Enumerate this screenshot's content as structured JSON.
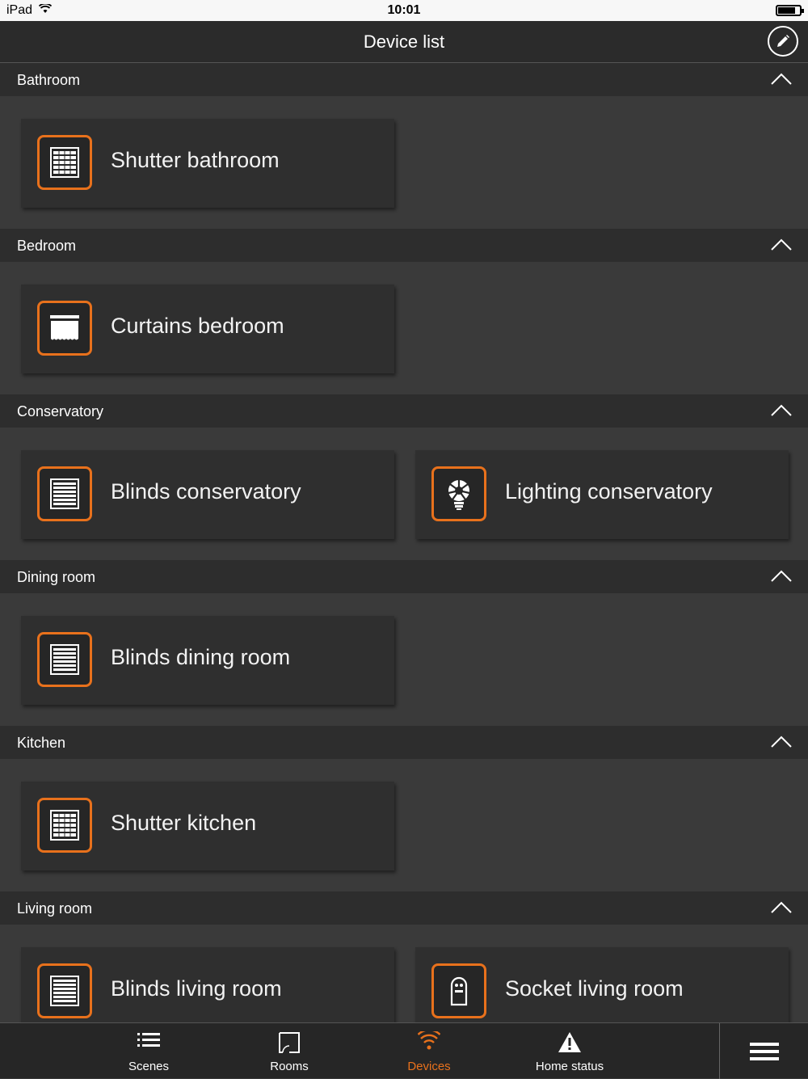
{
  "status_bar": {
    "device": "iPad",
    "time": "10:01"
  },
  "header": {
    "title": "Device list"
  },
  "colors": {
    "accent": "#e8711c",
    "background": "#3a3a3a",
    "header": "#2d2d2d"
  },
  "sections": [
    {
      "label": "Bathroom",
      "devices": [
        {
          "label": "Shutter bathroom",
          "icon": "shutter-icon"
        }
      ]
    },
    {
      "label": "Bedroom",
      "devices": [
        {
          "label": "Curtains bedroom",
          "icon": "curtains-icon"
        }
      ]
    },
    {
      "label": "Conservatory",
      "devices": [
        {
          "label": "Blinds conservatory",
          "icon": "blinds-icon"
        },
        {
          "label": "Lighting conservatory",
          "icon": "lightbulb-icon"
        }
      ]
    },
    {
      "label": "Dining room",
      "devices": [
        {
          "label": "Blinds dining room",
          "icon": "blinds-icon"
        }
      ]
    },
    {
      "label": "Kitchen",
      "devices": [
        {
          "label": "Shutter kitchen",
          "icon": "shutter-icon"
        }
      ]
    },
    {
      "label": "Living room",
      "devices": [
        {
          "label": "Blinds living room",
          "icon": "blinds-icon"
        },
        {
          "label": "Socket living room",
          "icon": "socket-icon"
        }
      ]
    }
  ],
  "tabs": [
    {
      "label": "Scenes",
      "icon": "list-icon"
    },
    {
      "label": "Rooms",
      "icon": "room-icon"
    },
    {
      "label": "Devices",
      "icon": "wifi-icon",
      "active": true
    },
    {
      "label": "Home status",
      "icon": "warning-icon"
    }
  ]
}
